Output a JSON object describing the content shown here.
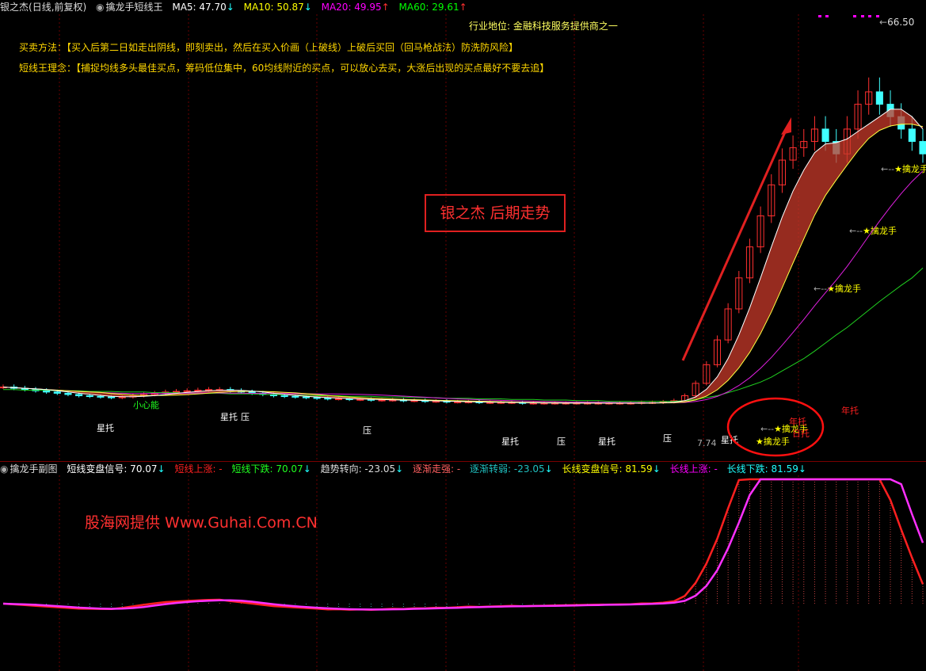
{
  "main_header": {
    "stock": "银之杰",
    "period": "(日线,前复权)",
    "indicator": "擒龙手短线王",
    "ma5": "MA5: 47.70",
    "ma5_arrow": "↓",
    "ma10": "MA10: 50.87",
    "ma10_arrow": "↓",
    "ma20": "MA20: 49.95",
    "ma20_arrow": "↑",
    "ma60": "MA60: 29.61",
    "ma60_arrow": "↑"
  },
  "notes": {
    "industry": "行业地位: 金融科技服务提供商之一",
    "method": "买卖方法：【买入后第二日如走出阴线，即刻卖出，然后在买入价画（上破线）上破后买回（回马枪战法）防洗防风险】",
    "concept": "短线王理念：【捕捉均线多头最佳买点，筹码低位集中，60均线附近的买点，可以放心去买，大涨后出现的买点最好不要去追】"
  },
  "callout": "银之杰 后期走势",
  "watermark": "股海网提供 Www.Guhai.Com.CN",
  "peak_label": "66.50",
  "low_label": "7.74",
  "signals": [
    "★擒龙手",
    "★擒龙手",
    "★擒龙手",
    "★擒龙手",
    "★擒龙手"
  ],
  "pattern_labels": [
    "小心能",
    "星托",
    "星托",
    "压",
    "压",
    "星托",
    "压",
    "星托",
    "压",
    "星托",
    "压",
    "年托",
    "日托",
    "年托"
  ],
  "sub_header": {
    "name": "擒龙手副图",
    "short_signal": "短线变盘信号: 70.07",
    "short_signal_arrow": "↓",
    "short_up": "短线上涨: -",
    "short_down": "短线下跌: 70.07",
    "short_down_arrow": "↓",
    "trend": "趋势转向: -23.05",
    "trend_arrow": "↓",
    "gradual_strong": "逐渐走强: -",
    "gradual_weak": "逐渐转弱: -23.05",
    "gradual_weak_arrow": "↓",
    "long_signal": "长线变盘信号: 81.59",
    "long_signal_arrow": "↓",
    "long_up": "长线上涨: -",
    "long_down": "长线下跌: 81.59",
    "long_down_arrow": "↓"
  },
  "colors": {
    "ma5": "#ffffff",
    "ma10": "#ffff00",
    "ma20": "#ff00ff",
    "ma60": "#00ff00",
    "up": "#ff2020",
    "down": "#20ffff",
    "accent": "#e02020"
  },
  "chart_data": {
    "type": "line",
    "ylim": [
      0,
      70
    ],
    "note": "price index by trading day (approximate)",
    "close": [
      10.4,
      10.2,
      10.0,
      9.8,
      9.6,
      9.4,
      9.2,
      9.0,
      8.9,
      8.8,
      8.7,
      8.8,
      9.0,
      9.2,
      9.4,
      9.6,
      9.7,
      9.8,
      9.9,
      10.0,
      10.0,
      9.8,
      9.6,
      9.4,
      9.2,
      9.0,
      8.9,
      8.8,
      8.7,
      8.6,
      8.5,
      8.5,
      8.4,
      8.4,
      8.3,
      8.3,
      8.3,
      8.2,
      8.2,
      8.1,
      8.1,
      8.0,
      8.0,
      8.0,
      7.9,
      7.9,
      7.9,
      7.9,
      7.8,
      7.8,
      7.8,
      7.8,
      7.8,
      7.8,
      7.8,
      7.8,
      7.8,
      7.8,
      7.8,
      7.9,
      7.9,
      8.0,
      8.2,
      9.0,
      11.0,
      14.0,
      18.0,
      23.0,
      28.0,
      33.0,
      38.0,
      43.0,
      47.0,
      49.0,
      50.0,
      52.0,
      50.0,
      48.0,
      52.0,
      56.0,
      58.0,
      56.0,
      54.0,
      52.0,
      50.0,
      48.0
    ],
    "ma60": [
      10.0,
      10.0,
      9.9,
      9.9,
      9.9,
      9.8,
      9.8,
      9.8,
      9.7,
      9.7,
      9.7,
      9.6,
      9.6,
      9.6,
      9.5,
      9.5,
      9.5,
      9.4,
      9.4,
      9.4,
      9.4,
      9.3,
      9.3,
      9.3,
      9.2,
      9.2,
      9.2,
      9.1,
      9.1,
      9.0,
      9.0,
      9.0,
      8.9,
      8.9,
      8.9,
      8.8,
      8.8,
      8.8,
      8.7,
      8.7,
      8.7,
      8.6,
      8.6,
      8.6,
      8.5,
      8.5,
      8.5,
      8.4,
      8.4,
      8.4,
      8.3,
      8.3,
      8.3,
      8.2,
      8.2,
      8.2,
      8.1,
      8.1,
      8.1,
      8.1,
      8.1,
      8.1,
      8.1,
      8.2,
      8.4,
      8.7,
      9.0,
      9.5,
      10.0,
      10.6,
      11.2,
      12.0,
      13.0,
      14.0,
      15.0,
      16.2,
      17.5,
      18.8,
      20.0,
      21.4,
      22.8,
      24.2,
      25.5,
      26.8,
      28.0,
      29.6
    ]
  }
}
